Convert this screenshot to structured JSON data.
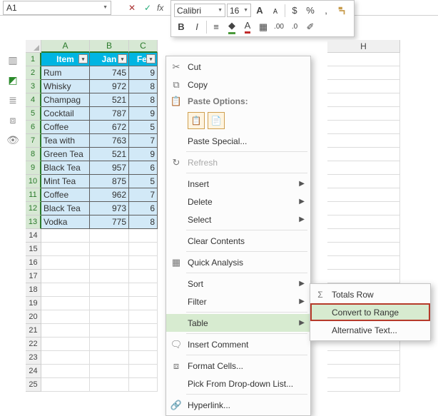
{
  "namebox": {
    "value": "A1"
  },
  "formula": {
    "cancel": "✕",
    "check": "✓",
    "fx": "fx"
  },
  "mini": {
    "font": "Calibri",
    "size": "16",
    "grow": "A",
    "shrink": "ᴀ",
    "currency": "$",
    "percent": "%",
    "comma": ",",
    "bold": "B",
    "italic": "I"
  },
  "columns": [
    {
      "label": "A",
      "w": 68,
      "sel": true
    },
    {
      "label": "B",
      "w": 55,
      "sel": true
    },
    {
      "label": "C",
      "w": 40,
      "sel": true
    },
    {
      "label": "H",
      "w": 102,
      "sel": false
    }
  ],
  "rows": [
    1,
    2,
    3,
    4,
    5,
    6,
    7,
    8,
    9,
    10,
    11,
    12,
    13,
    14,
    15,
    16,
    17,
    18,
    19,
    20,
    21,
    22,
    23,
    24,
    25
  ],
  "table": {
    "headers": [
      "Item",
      "Jan",
      "Fel"
    ],
    "data": [
      [
        "Rum",
        "745",
        "9"
      ],
      [
        "Whisky",
        "972",
        "8"
      ],
      [
        "Champag",
        "521",
        "8"
      ],
      [
        "Cocktail",
        "787",
        "9"
      ],
      [
        "Coffee",
        "672",
        "5"
      ],
      [
        "Tea with",
        "763",
        "7"
      ],
      [
        "Green Tea",
        "521",
        "9"
      ],
      [
        "Black Tea",
        "957",
        "6"
      ],
      [
        "Mint Tea",
        "875",
        "5"
      ],
      [
        "Coffee",
        "962",
        "7"
      ],
      [
        "Black Tea",
        "973",
        "6"
      ],
      [
        "Vodka",
        "775",
        "8"
      ]
    ]
  },
  "ctx": {
    "cut": "Cut",
    "copy": "Copy",
    "paste_options": "Paste Options:",
    "paste_special": "Paste Special...",
    "refresh": "Refresh",
    "insert": "Insert",
    "delete": "Delete",
    "select": "Select",
    "clear_contents": "Clear Contents",
    "quick_analysis": "Quick Analysis",
    "sort": "Sort",
    "filter": "Filter",
    "table": "Table",
    "insert_comment": "Insert Comment",
    "format_cells": "Format Cells...",
    "pick": "Pick From Drop-down List...",
    "hyperlink": "Hyperlink..."
  },
  "submenu": {
    "totals_row": "Totals Row",
    "convert_to_range": "Convert to Range",
    "alternative_text": "Alternative Text..."
  },
  "icons": {
    "cut": "✂",
    "copy": "⧉",
    "paste": "📋",
    "refresh": "↻",
    "qa": "▦",
    "comment": "🗨",
    "format": "⧈",
    "link": "🔗",
    "sigma": "Σ"
  }
}
